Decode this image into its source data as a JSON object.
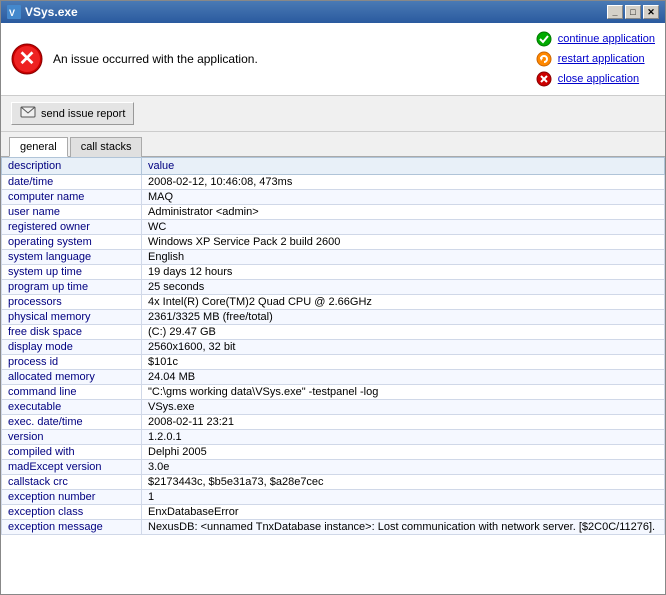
{
  "window": {
    "title": "VSys.exe",
    "controls": {
      "minimize": "_",
      "maximize": "□",
      "close": "✕"
    }
  },
  "header": {
    "error_message": "An issue occurred with the application.",
    "actions": [
      {
        "id": "continue",
        "label": "continue application",
        "icon": "check-icon",
        "color": "#00aa00"
      },
      {
        "id": "restart",
        "label": "restart application",
        "icon": "restart-icon",
        "color": "#ff8800"
      },
      {
        "id": "close",
        "label": "close application",
        "icon": "close-icon",
        "color": "#cc0000"
      }
    ]
  },
  "report_button": {
    "label": "send issue report"
  },
  "tabs": [
    {
      "id": "general",
      "label": "general",
      "active": true
    },
    {
      "id": "call_stacks",
      "label": "call stacks",
      "active": false
    }
  ],
  "table": {
    "headers": [
      "description",
      "value"
    ],
    "rows": [
      [
        "date/time",
        "2008-02-12, 10:46:08, 473ms"
      ],
      [
        "computer name",
        "MAQ"
      ],
      [
        "user name",
        "Administrator  <admin>"
      ],
      [
        "registered owner",
        "WC"
      ],
      [
        "operating system",
        "Windows XP Service Pack 2 build 2600"
      ],
      [
        "system language",
        "English"
      ],
      [
        "system up time",
        "19 days 12 hours"
      ],
      [
        "program up time",
        "25 seconds"
      ],
      [
        "processors",
        "4x Intel(R) Core(TM)2 Quad CPU      @ 2.66GHz"
      ],
      [
        "physical memory",
        "2361/3325 MB (free/total)"
      ],
      [
        "free disk space",
        "(C:) 29.47 GB"
      ],
      [
        "display mode",
        "2560x1600, 32 bit"
      ],
      [
        "process id",
        "$101c"
      ],
      [
        "allocated memory",
        "24.04 MB"
      ],
      [
        "command line",
        "\"C:\\gms working data\\VSys.exe\" -testpanel -log"
      ],
      [
        "executable",
        "VSys.exe"
      ],
      [
        "exec. date/time",
        "2008-02-11 23:21"
      ],
      [
        "version",
        "1.2.0.1"
      ],
      [
        "compiled with",
        "Delphi 2005"
      ],
      [
        "madExcept version",
        "3.0e"
      ],
      [
        "callstack crc",
        "$2173443c, $b5e31a73, $a28e7cec"
      ],
      [
        "exception number",
        "1"
      ],
      [
        "exception class",
        "EnxDatabaseError"
      ],
      [
        "exception message",
        "NexusDB: <unnamed TnxDatabase instance>: Lost communication with network server. [$2C0C/11276]."
      ]
    ]
  }
}
